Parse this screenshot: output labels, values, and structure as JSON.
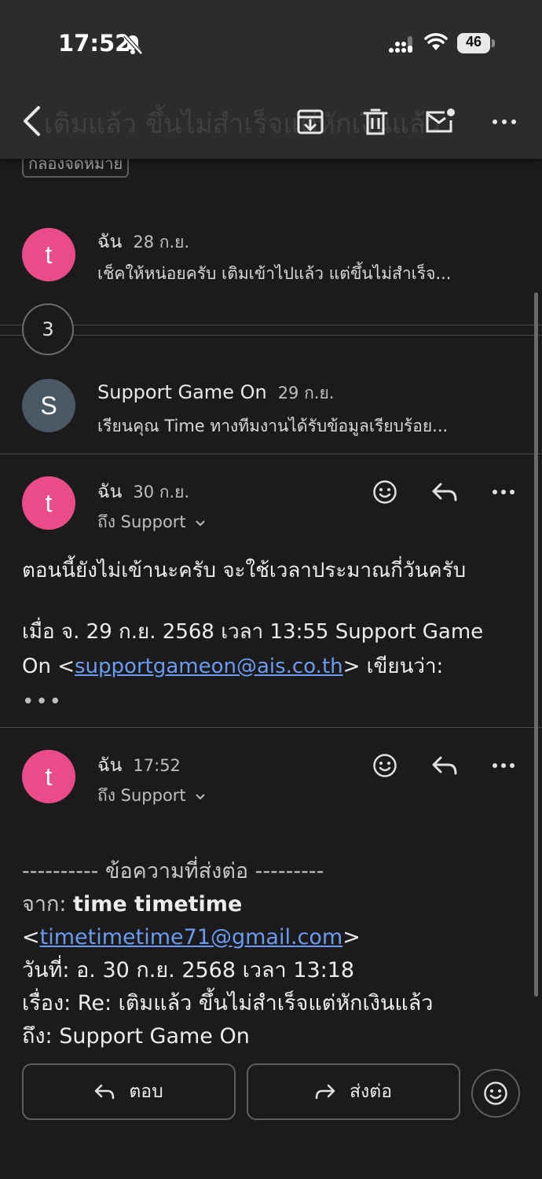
{
  "status_bar": {
    "time": "17:52",
    "battery": "46"
  },
  "toolbar": {
    "ghost_subject": "เติมแล้ว ขึ้นไม่สำเร็จแต่หักเงินแล้ว"
  },
  "label_chip": "กล่องจดหมาย",
  "thread": {
    "message1": {
      "avatar": "t",
      "sender": "ฉัน",
      "date": "28 ก.ย.",
      "snippet": "เช็คให้หน่อยครับ เติมเข้าไปแล้ว แต่ขึ้นไม่สำเร็จ..."
    },
    "collapsed_count": "3",
    "message2": {
      "avatar": "S",
      "sender": "Support Game On",
      "date": "29 ก.ย.",
      "snippet": "เรียนคุณ Time ทางทีมงานได้รับข้อมูลเรียบร้อย..."
    },
    "message3": {
      "avatar": "t",
      "sender": "ฉัน",
      "date": "30 ก.ย.",
      "to": "ถึง Support",
      "body": "ตอนนี้ยังไม่เข้านะครับ จะใช้เวลาประมาณกี่วันครับ",
      "quote_line1": "เมื่อ จ. 29 ก.ย. 2568 เวลา 13:55 Support Game",
      "quote_prefix": "On <",
      "quote_email": "supportgameon@ais.co.th",
      "quote_suffix": "> เขียนว่า:",
      "quote_more": "•••"
    },
    "message4": {
      "avatar": "t",
      "sender": "ฉัน",
      "date": "17:52",
      "to": "ถึง Support",
      "fwd_header": "---------- ข้อความที่ส่งต่อ ---------",
      "from_label": "จาก:",
      "from_name": "time timetime",
      "from_email": "timetimetime71@gmail.com",
      "date_line": "วันที่: อ. 30 ก.ย. 2568 เวลา 13:18",
      "subject_line": "เรื่อง: Re: เติมแล้ว ขึ้นไม่สำเร็จแต่หักเงินแล้ว",
      "to_line": "ถึง: Support Game On"
    }
  },
  "actions": {
    "reply": "ตอบ",
    "forward": "ส่งต่อ"
  }
}
